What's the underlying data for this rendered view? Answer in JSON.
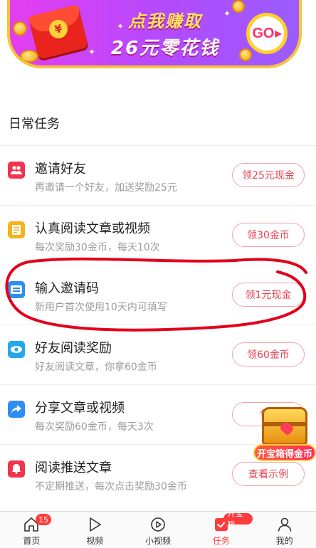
{
  "banner": {
    "line1": "点我赚取",
    "line2": "26元零花钱",
    "go_label": "GO",
    "packet_symbol": "¥"
  },
  "section": {
    "title": "日常任务"
  },
  "tasks": [
    {
      "icon": "people-icon",
      "icon_color": "#f0344d",
      "title": "邀请好友",
      "desc": "再邀请一个好友，加送奖励25元",
      "button": "领25元现金"
    },
    {
      "icon": "document-icon",
      "icon_color": "#f5b21b",
      "title": "认真阅读文章或视频",
      "desc": "每次奖励30金币，每天10次",
      "button": "领30金币"
    },
    {
      "icon": "invite-code-icon",
      "icon_color": "#2b8ff0",
      "title": "输入邀请码",
      "desc": "新用户首次使用10天内可填写",
      "button": "领1元现金"
    },
    {
      "icon": "eye-icon",
      "icon_color": "#23a9e8",
      "title": "好友阅读奖励",
      "desc": "好友阅读文章，你拿60金币",
      "button": "领60金币"
    },
    {
      "icon": "share-icon",
      "icon_color": "#2f8ef4",
      "title": "分享文章或视频",
      "desc": "每次奖励60金币，每天3次",
      "button": "领6"
    },
    {
      "icon": "bell-icon",
      "icon_color": "#f0344d",
      "title": "阅读推送文章",
      "desc": "不定期推送，每次点击奖励30金币",
      "button": "查看示例"
    }
  ],
  "chest": {
    "label": "开宝箱得金币"
  },
  "tabbar": {
    "accent": "#ff3b3b",
    "items": [
      {
        "label": "首页",
        "badge": "15",
        "icon": "home-icon"
      },
      {
        "label": "视频",
        "icon": "play-icon"
      },
      {
        "label": "小视频",
        "icon": "short-video-icon"
      },
      {
        "label": "任务",
        "badge": "开宝箱",
        "icon": "task-icon",
        "active": true
      },
      {
        "label": "我的",
        "icon": "profile-icon"
      }
    ]
  }
}
